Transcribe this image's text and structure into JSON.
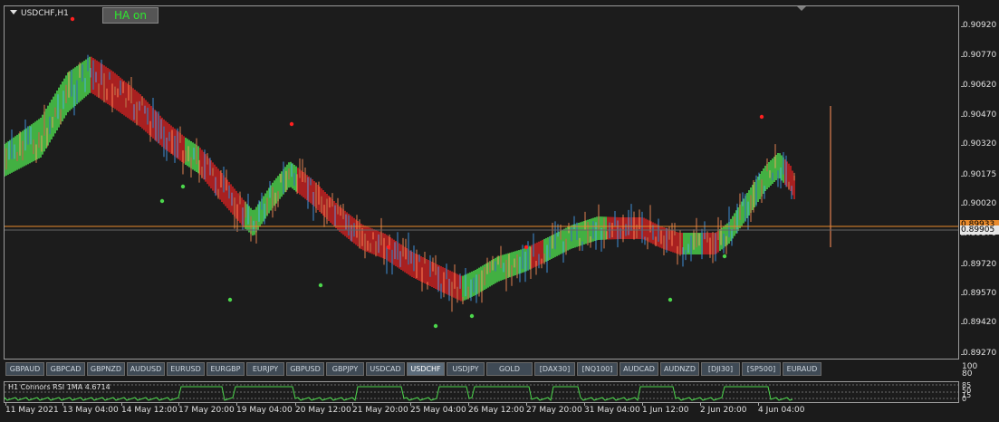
{
  "chart": {
    "title": "USDCHF,H1",
    "ha_button": "HA on",
    "bid_price": "0.89933",
    "current_price": "0.89905",
    "price_ticks": [
      "0.90920",
      "0.90770",
      "0.90620",
      "0.90470",
      "0.90320",
      "0.90175",
      "0.90020",
      "0.89870",
      "0.89720",
      "0.89570",
      "0.89420",
      "0.89270"
    ],
    "time_ticks": [
      "11 May 2021",
      "13 May 04:00",
      "14 May 12:00",
      "17 May 20:00",
      "19 May 04:00",
      "20 May 12:00",
      "21 May 20:00",
      "25 May 04:00",
      "26 May 12:00",
      "27 May 20:00",
      "31 May 04:00",
      "1 Jun 12:00",
      "2 Jun 20:00",
      "4 Jun 04:00"
    ],
    "colors": {
      "bull": "#4cd64c",
      "bear": "#cc2222",
      "candle_up": "#3e8ed6",
      "candle_down": "#e08050",
      "bid_line": "#e88a2c",
      "rsi_line": "#4cd64c"
    }
  },
  "symbols": [
    "GBPAUD",
    "GBPCAD",
    "GBPNZD",
    "AUDUSD",
    "EURUSD",
    "EURGBP",
    "EURJPY",
    "GBPUSD",
    "GBPJPY",
    "USDCAD",
    "USDCHF",
    "USDJPY",
    "GOLD",
    "[DAX30]",
    "[NQ100]",
    "AUDCAD",
    "AUDNZD",
    "[DJI30]",
    "[SP500]",
    "EURAUD"
  ],
  "active_symbol": "USDCHF",
  "rsi": {
    "title": "H1 Connors RSI 1MA 4.6714",
    "axis_top": [
      "100",
      "80"
    ],
    "axis_levels": [
      "85",
      "50",
      "15",
      "0"
    ]
  }
}
